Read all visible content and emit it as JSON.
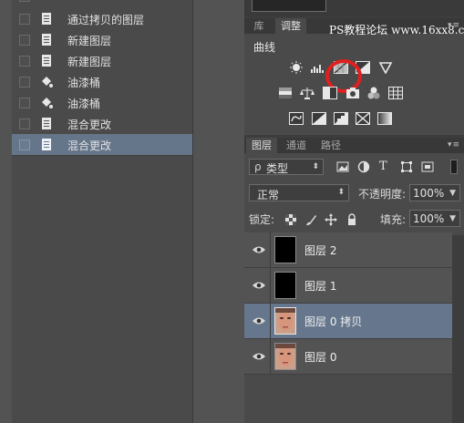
{
  "history": {
    "items": [
      {
        "label": "通过拷贝的图层",
        "icon": "document-icon",
        "selected": false
      },
      {
        "label": "新建图层",
        "icon": "document-icon",
        "selected": false
      },
      {
        "label": "新建图层",
        "icon": "document-icon",
        "selected": false
      },
      {
        "label": "油漆桶",
        "icon": "paint-bucket-icon",
        "selected": false
      },
      {
        "label": "油漆桶",
        "icon": "paint-bucket-icon",
        "selected": false
      },
      {
        "label": "混合更改",
        "icon": "document-icon",
        "selected": false
      },
      {
        "label": "混合更改",
        "icon": "document-icon",
        "selected": true
      }
    ]
  },
  "adjustments_panel": {
    "tabs": [
      {
        "label": "库",
        "active": false
      },
      {
        "label": "调整",
        "active": true
      }
    ],
    "menu_glyph": "▾≡",
    "watermark": "PS教程论坛 www.16xx8.com",
    "hover_label": "曲线",
    "highlight_color": "#e02020"
  },
  "layers_panel": {
    "tabs": [
      {
        "label": "图层",
        "active": true
      },
      {
        "label": "通道",
        "active": false
      },
      {
        "label": "路径",
        "active": false
      }
    ],
    "menu_glyph": "▾≡",
    "filter": {
      "prefix": "ρ",
      "value": "类型"
    },
    "blend_mode": "正常",
    "opacity_label": "不透明度:",
    "opacity_value": "100%",
    "lock_label": "锁定:",
    "fill_label": "填充:",
    "fill_value": "100%",
    "layers": [
      {
        "name": "图层 2",
        "thumb": "black",
        "visible": true,
        "selected": false
      },
      {
        "name": "图层 1",
        "thumb": "black",
        "visible": true,
        "selected": false
      },
      {
        "name": "图层 0 拷贝",
        "thumb": "face",
        "visible": true,
        "selected": true
      },
      {
        "name": "图层 0",
        "thumb": "face",
        "visible": true,
        "selected": false
      }
    ]
  }
}
